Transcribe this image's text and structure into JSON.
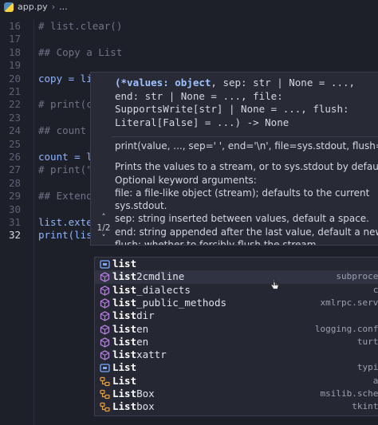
{
  "breadcrumb": {
    "file": "app.py",
    "rest": "..."
  },
  "lines": [
    {
      "num": "16",
      "text": "# list.clear()",
      "cls": "cm"
    },
    {
      "num": "17",
      "text": "",
      "cls": ""
    },
    {
      "num": "18",
      "text": "## Copy a List",
      "cls": "cm"
    },
    {
      "num": "19",
      "text": "",
      "cls": ""
    },
    {
      "num": "20",
      "text": "copy = li",
      "cls": "var"
    },
    {
      "num": "21",
      "text": "",
      "cls": ""
    },
    {
      "num": "22",
      "text": "# print(c",
      "cls": "cm"
    },
    {
      "num": "23",
      "text": "",
      "cls": ""
    },
    {
      "num": "24",
      "text": "## count a",
      "cls": "cm"
    },
    {
      "num": "25",
      "text": "",
      "cls": ""
    },
    {
      "num": "26",
      "text": "count = l",
      "cls": "var"
    },
    {
      "num": "27",
      "text": "# print(\"",
      "cls": "cm"
    },
    {
      "num": "28",
      "text": "",
      "cls": ""
    },
    {
      "num": "29",
      "text": "## Extend",
      "cls": "cm"
    },
    {
      "num": "30",
      "text": "",
      "cls": ""
    },
    {
      "num": "31",
      "text": "list.exte",
      "cls": "var"
    },
    {
      "num": "32",
      "text": "print(list)",
      "cls": "fn"
    }
  ],
  "hover": {
    "sig_bold": "(*values: object",
    "sig_rest": ", sep: str | None = ..., end: str | None = ..., file: SupportsWrite[str] | None = ..., flush: Literal[False] = ...) -> None",
    "example": "print(value, ..., sep=' ', end='\\n', file=sys.stdout, flush=False)",
    "doc1": "Prints the values to a stream, or to sys.stdout by default.",
    "doc2": "Optional keyword arguments:",
    "doc3": "file: a file-like object (stream); defaults to the current",
    "doc4": "sys.stdout.",
    "doc5": "sep: string inserted between values, default a space.",
    "doc6": "end: string appended after the last value, default a newline.",
    "doc7": "flush: whether to forcibly flush the stream.",
    "nav_up": "˄",
    "nav_count": "1/2",
    "nav_down": "˅"
  },
  "completions": [
    {
      "match": "list",
      "rest": "",
      "src": "",
      "kind": "class-blue"
    },
    {
      "match": "list",
      "rest": "2cmdline",
      "src": "subproces",
      "kind": "module"
    },
    {
      "match": "list",
      "rest": "_dialects",
      "src": "cs",
      "kind": "module"
    },
    {
      "match": "list",
      "rest": "_public_methods",
      "src": "xmlrpc.serve",
      "kind": "module"
    },
    {
      "match": "list",
      "rest": "dir",
      "src": "o",
      "kind": "module"
    },
    {
      "match": "list",
      "rest": "en",
      "src": "logging.confi",
      "kind": "module"
    },
    {
      "match": "list",
      "rest": "en",
      "src": "turtl",
      "kind": "module"
    },
    {
      "match": "list",
      "rest": "xattr",
      "src": "o",
      "kind": "module"
    },
    {
      "match": "List",
      "rest": "",
      "src": "typin",
      "kind": "class-blue"
    },
    {
      "match": "List",
      "rest": "",
      "src": "as",
      "kind": "class-orange"
    },
    {
      "match": "List",
      "rest": "Box",
      "src": "msilib.schem",
      "kind": "class-orange"
    },
    {
      "match": "List",
      "rest": "box",
      "src": "tkinte",
      "kind": "class-orange"
    }
  ],
  "colors": {
    "module": "#b57edc",
    "class-blue": "#7aa7ff",
    "class-orange": "#e8a045",
    "background": "#1e2029"
  }
}
